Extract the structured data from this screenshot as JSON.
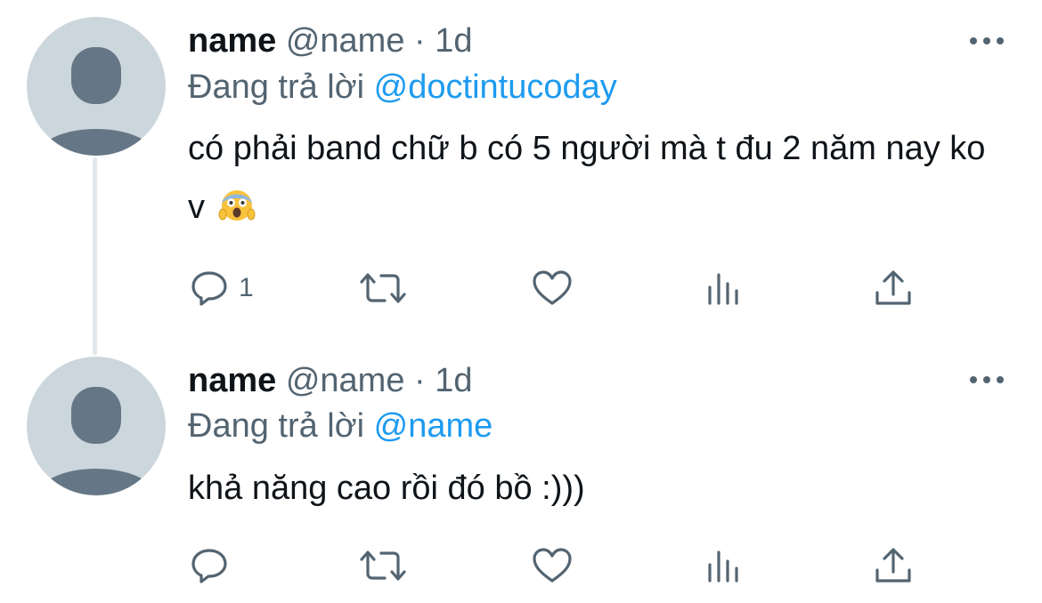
{
  "tweets": [
    {
      "display_name": "name",
      "handle": "@name",
      "separator": "·",
      "time": "1d",
      "reply_prefix": "Đang trả lời",
      "reply_to": "@doctintucoday",
      "text": "có phải band chữ b có 5 người mà t đu 2 năm nay ko v",
      "emoji": "face-screaming-in-fear",
      "reply_count": "1"
    },
    {
      "display_name": "name",
      "handle": "@name",
      "separator": "·",
      "time": "1d",
      "reply_prefix": "Đang trả lời",
      "reply_to": "@name",
      "text": "khả năng cao rồi đó bồ :)))",
      "reply_count": ""
    }
  ],
  "icons": {
    "reply": "reply-icon",
    "retweet": "retweet-icon",
    "like": "heart-icon",
    "views": "views-icon",
    "share": "share-icon",
    "more": "more-icon",
    "avatar": "default-avatar-icon"
  },
  "colors": {
    "background": "#ffffff",
    "primary_text": "#0f1419",
    "secondary_text": "#536471",
    "link": "#1d9bf0",
    "avatar_bg": "#ccd6dd",
    "avatar_fg": "#657786",
    "thread_line": "#e1e8ed"
  }
}
